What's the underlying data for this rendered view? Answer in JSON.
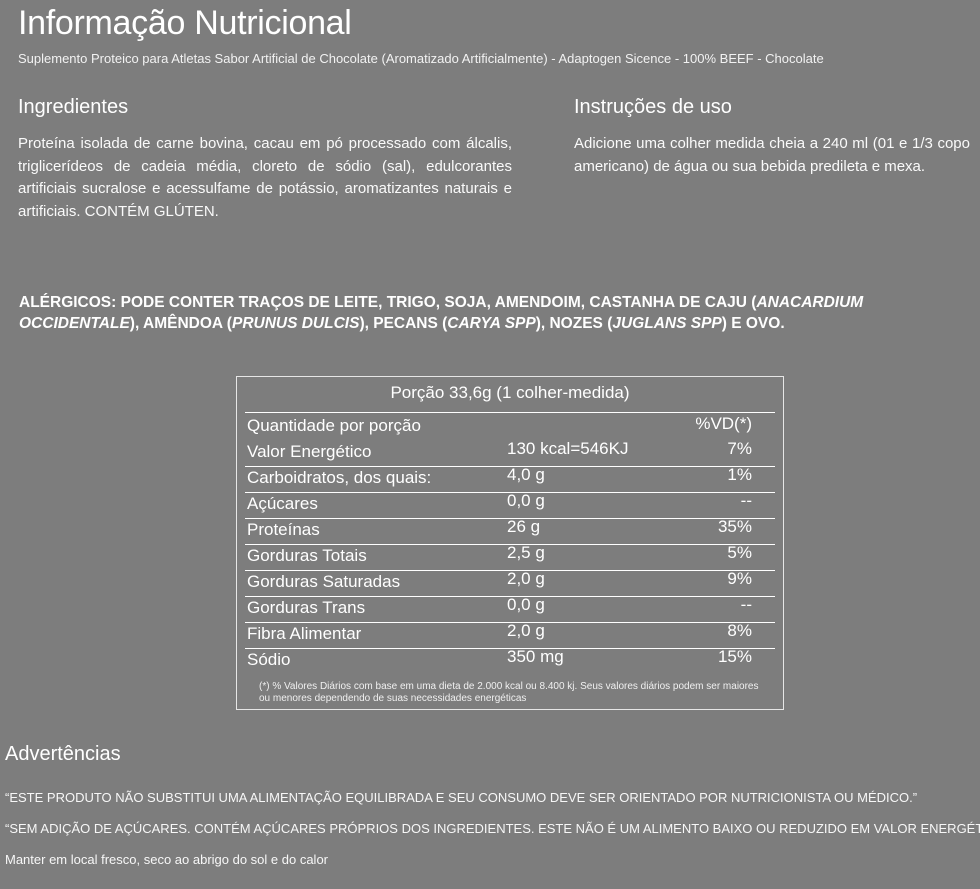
{
  "header": {
    "title": "Informação Nutricional",
    "subtitle": "Suplemento Proteico para Atletas  Sabor Artificial de Chocolate (Aromatizado Artificialmente) - Adaptogen Sicence - 100% BEEF - Chocolate"
  },
  "ingredients": {
    "heading": "Ingredientes",
    "text": "Proteína isolada de carne bovina, cacau em pó processado com álcalis, triglicerídeos de cadeia média, cloreto de sódio (sal), edulcorantes artificiais sucralose e acessulfame de potássio, aromatizantes naturais e artificiais.  CONTÉM GLÚTEN."
  },
  "instructions": {
    "heading": "Instruções de uso",
    "text": "Adicione uma colher medida cheia a 240 ml (01 e 1/3 copo americano) de água ou sua bebida predileta e mexa."
  },
  "allergens": {
    "prefix": "ALÉRGICOS: PODE CONTER TRAÇOS DE LEITE, TRIGO, SOJA, AMENDOIM, CASTANHA DE CAJU (",
    "sci1": "ANACARDIUM OCCIDENTALE",
    "mid1": "), AMÊNDOA (",
    "sci2": "PRUNUS DULCIS",
    "mid2": "), PECANS (",
    "sci3": "CARYA SPP",
    "mid3": "), NOZES (",
    "sci4": "JUGLANS SPP",
    "suffix": ") E OVO."
  },
  "nutrition": {
    "portion": "Porção 33,6g (1 colher-medida)",
    "qty_header": "Quantidade por porção",
    "vd_header": "%VD(*)",
    "rows": [
      {
        "name": "Valor Energético",
        "qty": "130 kcal=546KJ",
        "vd": "7%"
      },
      {
        "name": "Carboidratos, dos quais:",
        "qty": "4,0 g",
        "vd": "1%"
      },
      {
        "name": "Açúcares",
        "qty": "0,0 g",
        "vd": "--"
      },
      {
        "name": "Proteínas",
        "qty": "26 g",
        "vd": "35%"
      },
      {
        "name": "Gorduras Totais",
        "qty": "2,5 g",
        "vd": "5%"
      },
      {
        "name": "Gorduras Saturadas",
        "qty": "2,0 g",
        "vd": "9%"
      },
      {
        "name": "Gorduras Trans",
        "qty": "0,0 g",
        "vd": "--"
      },
      {
        "name": "Fibra Alimentar",
        "qty": "2,0 g",
        "vd": "8%"
      },
      {
        "name": "Sódio",
        "qty": "350 mg",
        "vd": "15%"
      }
    ],
    "footnote": "(*) % Valores Diários com base em uma dieta de 2.000 kcal ou 8.400 kj. Seus valores diários podem ser maiores ou menores dependendo de suas necessidades energéticas"
  },
  "warnings": {
    "heading": "Advertências",
    "line1": "“ESTE PRODUTO NÃO SUBSTITUI UMA ALIMENTAÇÃO EQUILIBRADA E SEU CONSUMO DEVE SER ORIENTADO POR NUTRICIONISTA OU MÉDICO.”",
    "line2": "“SEM ADIÇÃO DE AÇÚCARES. CONTÉM AÇÚCARES PRÓPRIOS DOS INGREDIENTES. ESTE NÃO É UM ALIMENTO BAIXO OU REDUZIDO EM VALOR ENERGÉTICO.”",
    "line3": "Manter em local fresco, seco ao abrigo do sol e do calor"
  }
}
